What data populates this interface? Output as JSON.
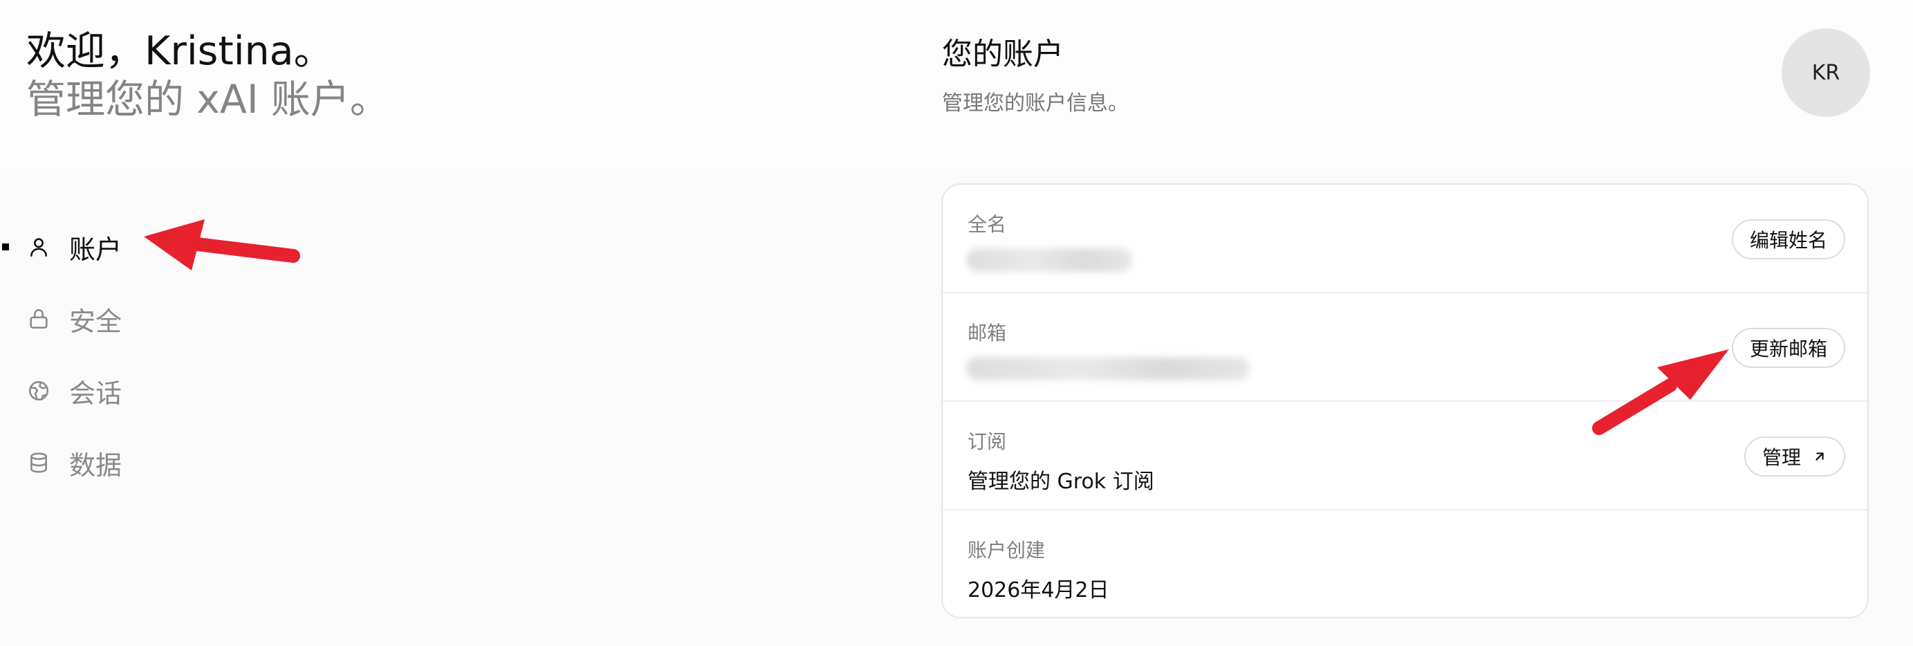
{
  "welcome": {
    "greeting": "欢迎，Kristina。",
    "subtitle": "管理您的 xAI 账户。"
  },
  "nav": {
    "items": [
      {
        "label": "账户",
        "icon": "user-icon",
        "active": true
      },
      {
        "label": "安全",
        "icon": "lock-icon",
        "active": false
      },
      {
        "label": "会话",
        "icon": "globe-icon",
        "active": false
      },
      {
        "label": "数据",
        "icon": "database-icon",
        "active": false
      }
    ]
  },
  "account": {
    "title": "您的账户",
    "subtitle": "管理您的账户信息。",
    "avatar_initials": "KR"
  },
  "card": {
    "full_name": {
      "label": "全名",
      "button": "编辑姓名"
    },
    "email": {
      "label": "邮箱",
      "button": "更新邮箱"
    },
    "subscription": {
      "label": "订阅",
      "value": "管理您的 Grok 订阅",
      "button": "管理"
    },
    "created": {
      "label": "账户创建",
      "value": "2026年4月2日"
    }
  },
  "colors": {
    "annotation_arrow": "#e8212e",
    "muted_text": "#858585"
  }
}
